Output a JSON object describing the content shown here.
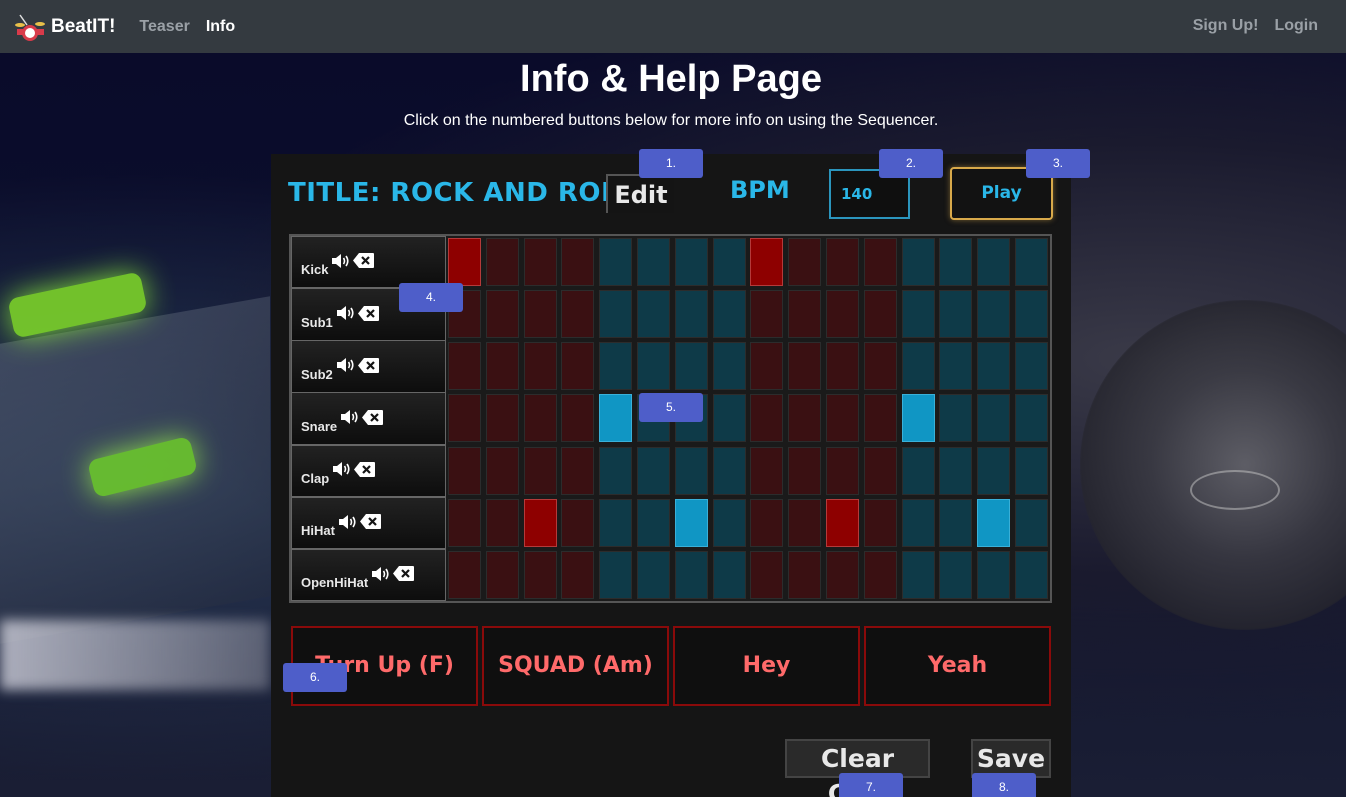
{
  "navbar": {
    "brand": "BeatIT!",
    "links": [
      "Teaser",
      "Info"
    ],
    "right_links": [
      "Sign Up!",
      "Login"
    ]
  },
  "page": {
    "title": "Info & Help Page",
    "subtitle": "Click on the numbered buttons below for more info on using the Sequencer."
  },
  "sequencer": {
    "title": "TITLE: ROCK AND ROLL",
    "edit_label": "Edit",
    "bpm_label": "BPM",
    "bpm_value": "140",
    "play_label": "Play",
    "rows": [
      {
        "name": "Kick",
        "active": [
          0,
          8
        ]
      },
      {
        "name": "Sub1",
        "active": []
      },
      {
        "name": "Sub2",
        "active": []
      },
      {
        "name": "Snare",
        "active": [
          4,
          12
        ]
      },
      {
        "name": "Clap",
        "active": []
      },
      {
        "name": "HiHat",
        "active": [
          2,
          6,
          10,
          14
        ]
      },
      {
        "name": "OpenHiHat",
        "active": []
      }
    ],
    "steps": 16,
    "pads": [
      "Turn Up (F)",
      "SQUAD (Am)",
      "Hey",
      "Yeah"
    ],
    "clear_label": "Clear Grid",
    "save_label": "Save"
  },
  "hints": [
    "1.",
    "2.",
    "3.",
    "4.",
    "5.",
    "6.",
    "7.",
    "8."
  ],
  "colors": {
    "accent_blue": "#2ab7e8",
    "pad_red": "#ff6a6a",
    "hint_blue": "#4e5ec9"
  }
}
